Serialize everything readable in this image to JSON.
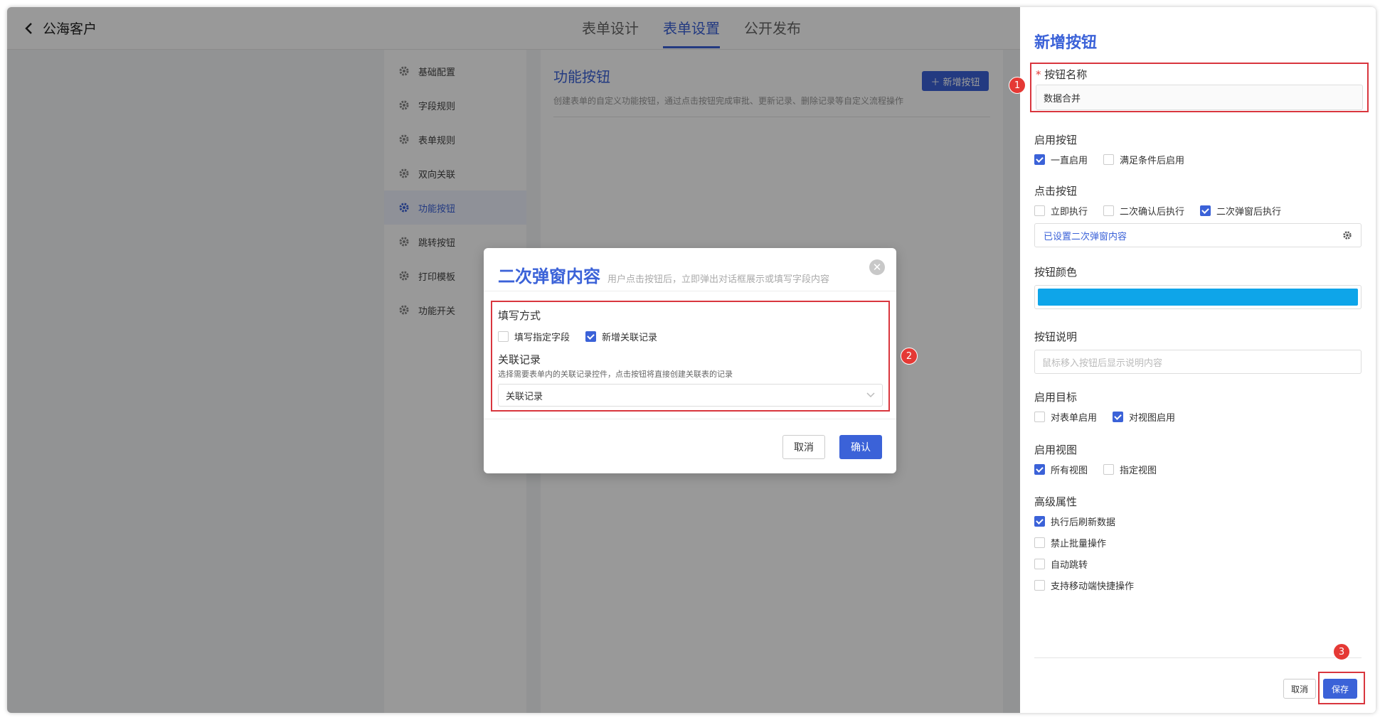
{
  "header": {
    "back_title": "公海客户",
    "tabs": [
      {
        "label": "表单设计"
      },
      {
        "label": "表单设置"
      },
      {
        "label": "公开发布"
      }
    ]
  },
  "menu": {
    "items": [
      {
        "label": "基础配置"
      },
      {
        "label": "字段规则"
      },
      {
        "label": "表单规则"
      },
      {
        "label": "双向关联"
      },
      {
        "label": "功能按钮"
      },
      {
        "label": "跳转按钮"
      },
      {
        "label": "打印模板"
      },
      {
        "label": "功能开关"
      }
    ]
  },
  "content": {
    "title": "功能按钮",
    "description": "创建表单的自定义功能按钮，通过点击按钮完成审批、更新记录、删除记录等自定义流程操作",
    "add_button": "新增按钮"
  },
  "modal": {
    "title": "二次弹窗内容",
    "subtitle": "用户点击按钮后，立即弹出对话框展示或填写字段内容",
    "fill_mode_label": "填写方式",
    "fill_options": [
      {
        "label": "填写指定字段",
        "checked": false
      },
      {
        "label": "新增关联记录",
        "checked": true
      }
    ],
    "relation_label": "关联记录",
    "relation_hint": "选择需要表单内的关联记录控件，点击按钮将直接创建关联表的记录",
    "relation_select_value": "关联记录",
    "cancel": "取消",
    "confirm": "确认"
  },
  "badges": {
    "one": "1",
    "two": "2",
    "three": "3"
  },
  "drawer": {
    "title": "新增按钮",
    "name_label": "按钮名称",
    "name_required_mark": "*",
    "name_value": "数据合并",
    "enable_label": "启用按钮",
    "enable_options": [
      {
        "label": "一直启用",
        "checked": true
      },
      {
        "label": "满足条件后启用",
        "checked": false
      }
    ],
    "click_label": "点击按钮",
    "click_options": [
      {
        "label": "立即执行",
        "checked": false
      },
      {
        "label": "二次确认后执行",
        "checked": false
      },
      {
        "label": "二次弹窗后执行",
        "checked": true
      }
    ],
    "popup_setting": "已设置二次弹窗内容",
    "color_label": "按钮颜色",
    "color_value": "#0ea5e9",
    "desc_label": "按钮说明",
    "desc_placeholder": "鼠标移入按钮后显示说明内容",
    "target_label": "启用目标",
    "target_options": [
      {
        "label": "对表单启用",
        "checked": false
      },
      {
        "label": "对视图启用",
        "checked": true
      }
    ],
    "view_label": "启用视图",
    "view_options": [
      {
        "label": "所有视图",
        "checked": true
      },
      {
        "label": "指定视图",
        "checked": false
      }
    ],
    "advanced_label": "高级属性",
    "advanced_options": [
      {
        "label": "执行后刷新数据",
        "checked": true
      },
      {
        "label": "禁止批量操作",
        "checked": false
      },
      {
        "label": "自动跳转",
        "checked": false
      },
      {
        "label": "支持移动端快捷操作",
        "checked": false
      }
    ],
    "cancel": "取消",
    "save": "保存"
  },
  "colors": {
    "accent": "#3b62d8",
    "highlight": "#d9363e"
  }
}
